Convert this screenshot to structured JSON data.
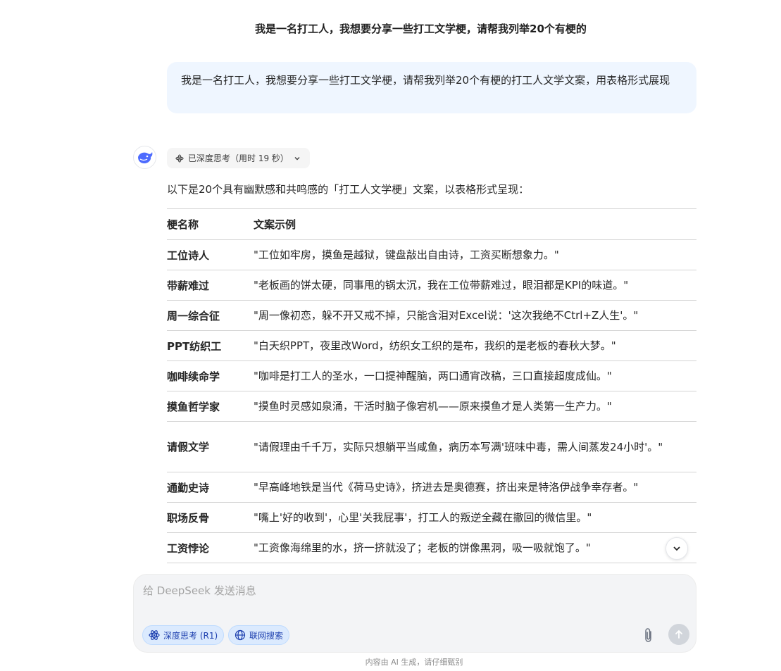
{
  "chat": {
    "title": "我是一名打工人，我想要分享一些打工文学梗，请帮我列举20个有梗的"
  },
  "user_message": {
    "text": "我是一名打工人，我想要分享一些打工文学梗，请帮我列举20个有梗的打工人文学文案，用表格形式展现"
  },
  "assistant": {
    "avatar_icon": "deepseek-whale-icon",
    "think_label": "已深度思考（用时 19 秒）",
    "intro": "以下是20个具有幽默感和共鸣感的「打工人文学梗」文案，以表格形式呈现：",
    "table": {
      "headers": [
        "梗名称",
        "文案示例"
      ],
      "rows": [
        {
          "name": "工位诗人",
          "text": "\"工位如牢房，摸鱼是越狱，键盘敲出自由诗，工资买断想象力。\""
        },
        {
          "name": "带薪难过",
          "text": "\"老板画的饼太硬，同事甩的锅太沉，我在工位带薪难过，眼泪都是KPI的味道。\""
        },
        {
          "name": "周一综合征",
          "text": "\"周一像初恋，躲不开又戒不掉，只能含泪对Excel说：'这次我绝不Ctrl+Z人生'。\""
        },
        {
          "name": "PPT纺织工",
          "text": "\"白天织PPT，夜里改Word，纺织女工织的是布，我织的是老板的春秋大梦。\""
        },
        {
          "name": "咖啡续命学",
          "text": "\"咖啡是打工人的圣水，一口提神醒脑，两口通宵改稿，三口直接超度成仙。\""
        },
        {
          "name": "摸鱼哲学家",
          "text": "\"摸鱼时灵感如泉涌，干活时脑子像宕机——原来摸鱼才是人类第一生产力。\""
        },
        {
          "name": "请假文学",
          "text": "\"请假理由千千万，实际只想躺平当咸鱼，病历本写满'班味中毒，需人间蒸发24小时'。\""
        },
        {
          "name": "通勤史诗",
          "text": "\"早高峰地铁是当代《荷马史诗》，挤进去是奥德赛，挤出来是特洛伊战争幸存者。\""
        },
        {
          "name": "职场反骨",
          "text": "\"嘴上'好的收到'，心里'关我屁事'，打工人的叛逆全藏在撤回的微信里。\""
        },
        {
          "name": "工资悖论",
          "text": "\"工资像海绵里的水，挤一挤就没了；老板的饼像黑洞，吸一吸就饱了。\""
        }
      ]
    }
  },
  "composer": {
    "placeholder": "给 DeepSeek 发送消息",
    "deep_think_label": "深度思考 (R1)",
    "web_search_label": "联网搜索"
  },
  "footer": {
    "disclaimer": "内容由 AI 生成，请仔细甄别"
  },
  "colors": {
    "accent": "#4d6bfe",
    "user_bubble_bg": "#eff6ff",
    "chip_bg": "#dbeafe",
    "send_disabled": "#d1d5db"
  }
}
